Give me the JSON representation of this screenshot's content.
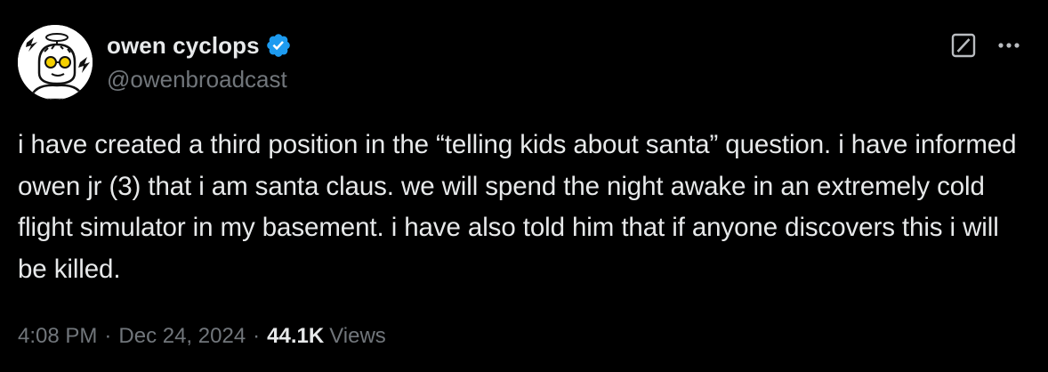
{
  "author": {
    "display_name": "owen cyclops",
    "handle": "@owenbroadcast",
    "verified": true
  },
  "tweet": {
    "text": "i have created a third position in the “telling kids about santa” question. i have informed owen jr (3) that i am santa claus. we will spend the night awake in an extremely cold flight simulator in my basement. i have also told him that if anyone discovers this i will be killed."
  },
  "meta": {
    "time": "4:08 PM",
    "separator": "·",
    "date": "Dec 24, 2024",
    "views_count": "44.1K",
    "views_label": "Views"
  },
  "icons": {
    "verified": "verified-badge-icon",
    "grok": "grok-icon",
    "more": "more-dots-icon"
  },
  "colors": {
    "background": "#000000",
    "primary_text": "#e7e9ea",
    "secondary_text": "#71767b",
    "verified_blue": "#1d9bf0"
  }
}
